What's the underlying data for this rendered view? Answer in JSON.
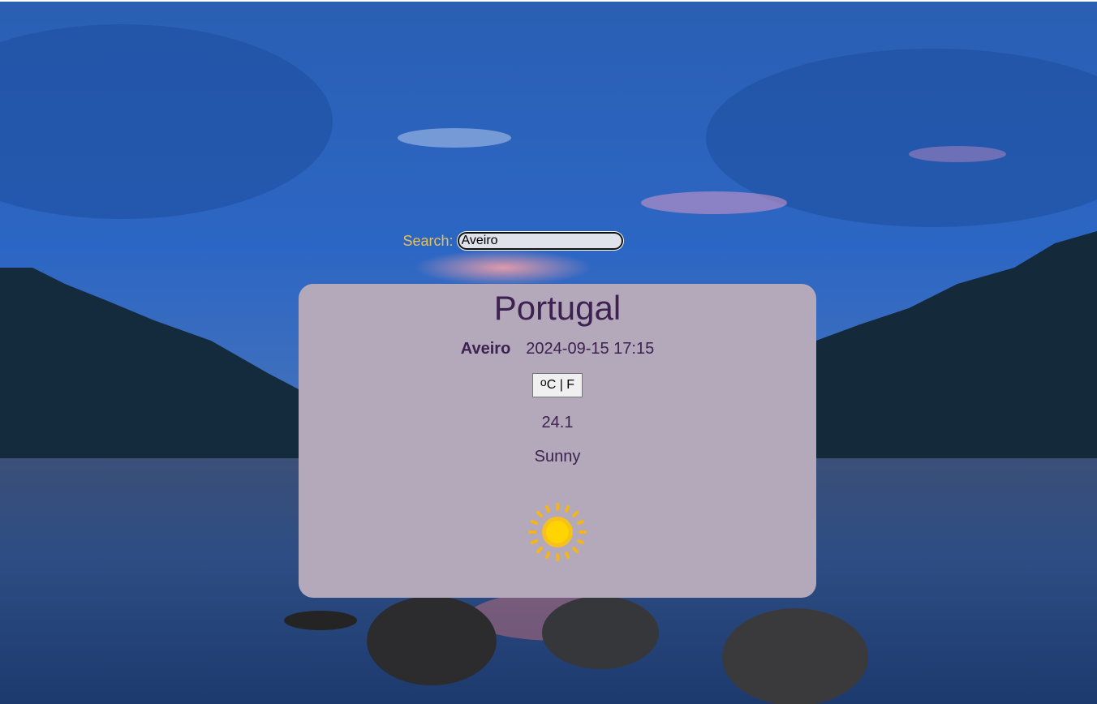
{
  "search": {
    "label": "Search:",
    "value": "Aveiro"
  },
  "weather": {
    "country": "Portugal",
    "city": "Aveiro",
    "datetime": "2024-09-15 17:15",
    "unit_toggle": {
      "sup": "o",
      "text": "C | F"
    },
    "temperature": "24.1",
    "condition": "Sunny",
    "icon": "sun-icon"
  },
  "colors": {
    "card": "#b4a9ba",
    "text": "#3d2150",
    "search_label": "#e3c25a",
    "sun": "#ffd400"
  }
}
